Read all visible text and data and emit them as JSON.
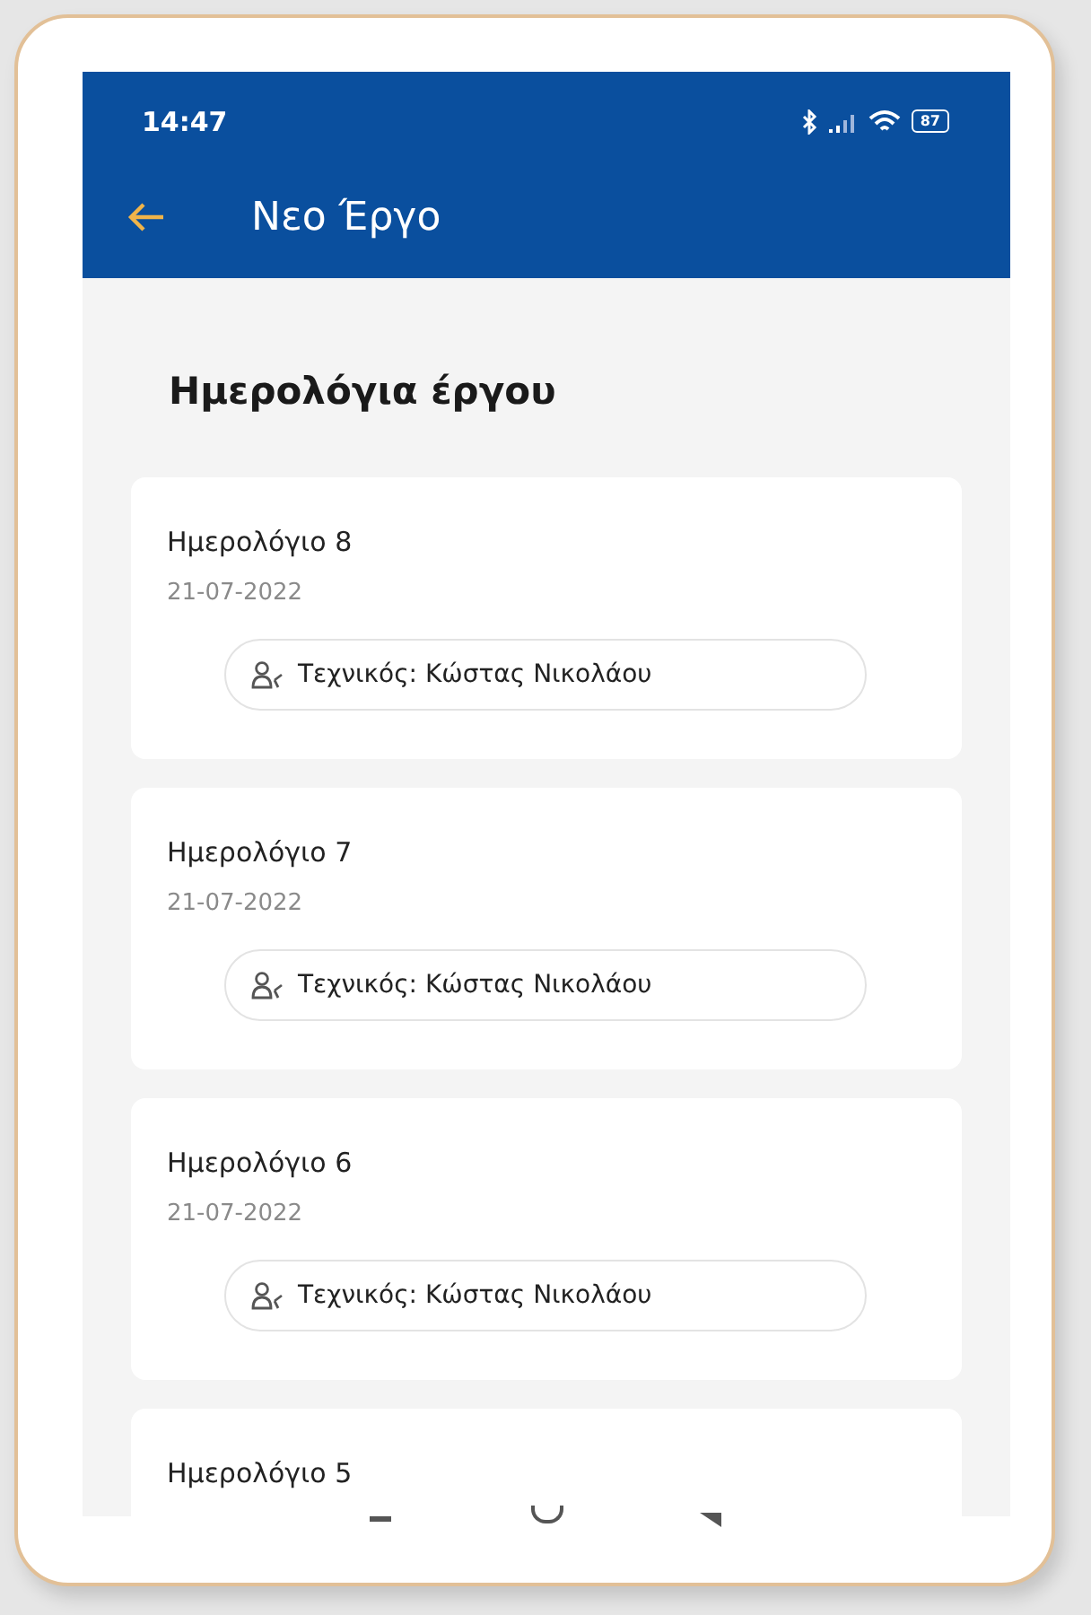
{
  "status_bar": {
    "time": "14:47",
    "battery": "87"
  },
  "app_bar": {
    "title": "Νεο Έργο"
  },
  "heading": "Ημερολόγια έργου",
  "logs": [
    {
      "title": "Ημερολόγιο 8",
      "date": "21-07-2022",
      "technician": "Τεχνικός: Κώστας Νικολάου"
    },
    {
      "title": "Ημερολόγιο 7",
      "date": "21-07-2022",
      "technician": "Τεχνικός: Κώστας Νικολάου"
    },
    {
      "title": "Ημερολόγιο 6",
      "date": "21-07-2022",
      "technician": "Τεχνικός: Κώστας Νικολάου"
    },
    {
      "title": "Ημερολόγιο 5"
    }
  ]
}
